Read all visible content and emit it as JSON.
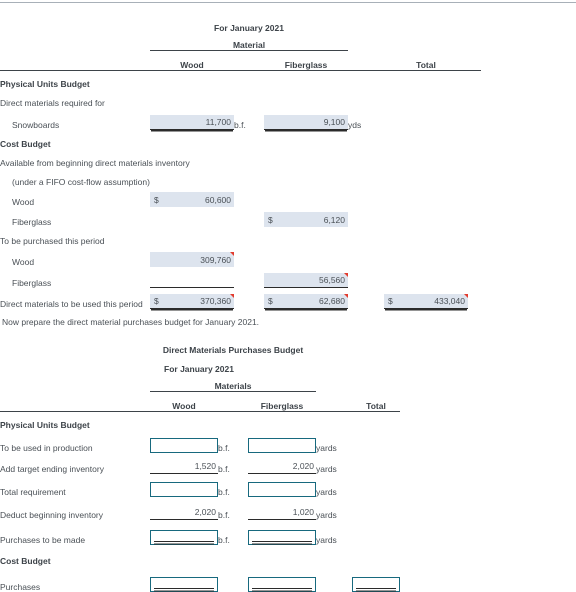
{
  "top_section": {
    "subtitle": "For January 2021",
    "group_header": "Material",
    "columns": [
      "Wood",
      "Fiberglass",
      "Total"
    ],
    "sections": [
      {
        "heading": "Physical Units Budget"
      },
      {
        "label": "Direct materials required for"
      },
      {
        "label": "Snowboards",
        "wood": "11,700",
        "wood_unit": "b.f.",
        "fiberglass": "9,100",
        "fiberglass_unit": "yds"
      },
      {
        "heading": "Cost Budget"
      },
      {
        "label": "Available from beginning direct materials inventory"
      },
      {
        "label": "(under a FIFO cost-flow assumption)"
      },
      {
        "label": "Wood",
        "currency": "$",
        "wood": "60,600"
      },
      {
        "label": "Fiberglass",
        "currency": "$",
        "fiberglass": "6,120"
      },
      {
        "label": "To be purchased this period"
      },
      {
        "label": "Wood",
        "wood": "309,760"
      },
      {
        "label": "Fiberglass",
        "fiberglass": "56,560"
      },
      {
        "label": "Direct materials to be used this period",
        "currency": "$",
        "wood": "370,360",
        "fiberglass": "62,680",
        "total": "433,040"
      }
    ]
  },
  "instruction": "Now prepare the direct material purchases budget for January 2021.",
  "bottom_section": {
    "title": "Direct Materials Purchases Budget",
    "subtitle": "For January 2021",
    "group_header": "Materials",
    "columns": [
      "Wood",
      "Fiberglass",
      "Total"
    ],
    "physical_units_heading": "Physical Units Budget",
    "cost_budget_heading": "Cost Budget",
    "unit_wood": "b.f.",
    "unit_fiberglass": "yards",
    "rows": [
      {
        "label": "To be used in production",
        "wood": "",
        "fiberglass": "",
        "kind": "input"
      },
      {
        "label": "Add target ending inventory",
        "wood": "1,520",
        "fiberglass": "2,020",
        "kind": "underline"
      },
      {
        "label": "Total requirement",
        "wood": "",
        "fiberglass": "",
        "kind": "input"
      },
      {
        "label": "Deduct beginning inventory",
        "wood": "2,020",
        "fiberglass": "1,020",
        "kind": "underline"
      },
      {
        "label": "Purchases to be made",
        "wood": "",
        "fiberglass": "",
        "kind": "input-total"
      }
    ],
    "purchases_row": {
      "label": "Purchases",
      "wood": "",
      "fiberglass": "",
      "total": ""
    }
  }
}
